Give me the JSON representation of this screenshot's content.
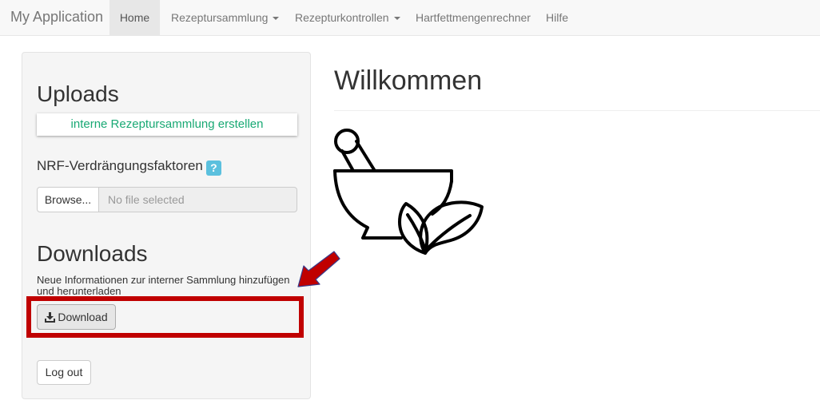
{
  "navbar": {
    "brand": "My Application",
    "items": [
      {
        "label": "Home",
        "active": true
      },
      {
        "label": "Rezeptursammlung",
        "dropdown": true
      },
      {
        "label": "Rezepturkontrollen",
        "dropdown": true
      },
      {
        "label": "Hartfettmengenrechner"
      },
      {
        "label": "Hilfe"
      }
    ]
  },
  "sidebar": {
    "uploads_heading": "Uploads",
    "create_button": "interne Rezeptursammlung erstellen",
    "nrf_label": "NRF-Verdrängungsfaktoren",
    "help_icon": "?",
    "browse_button": "Browse...",
    "file_placeholder": "No file selected",
    "downloads_heading": "Downloads",
    "downloads_info": "Neue Informationen zur interner Sammlung hinzufügen und herunterladen",
    "download_button": "Download",
    "logout_button": "Log out"
  },
  "main": {
    "title": "Willkommen",
    "image": "mortar-pestle-herb-icon"
  },
  "colors": {
    "accent_green": "#19a974",
    "highlight_red": "#c00000",
    "help_blue": "#5bc0de"
  }
}
